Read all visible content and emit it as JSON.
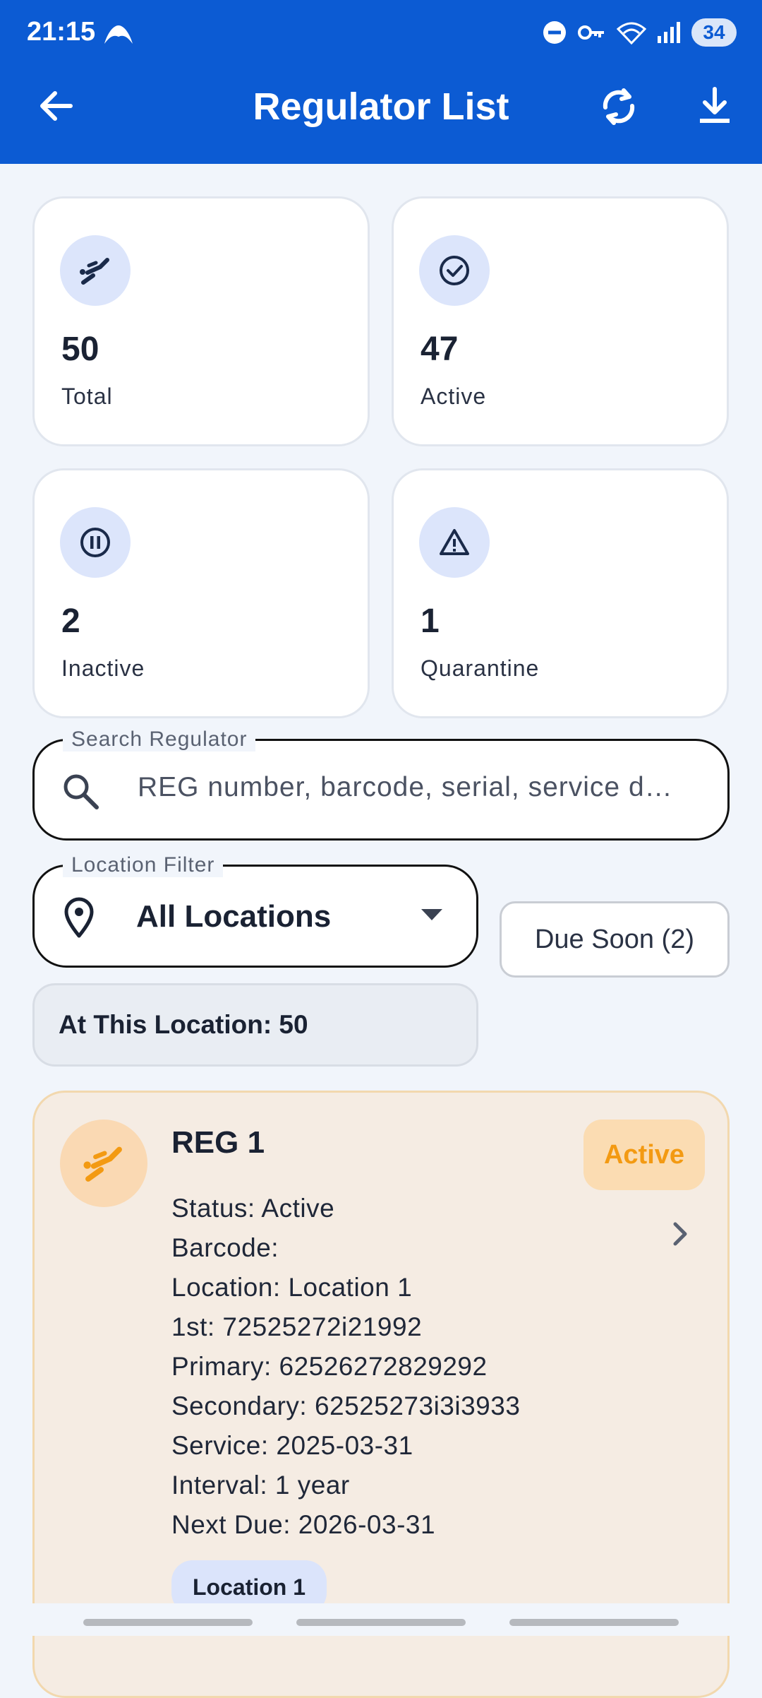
{
  "status_bar": {
    "time": "21:15",
    "battery": "34"
  },
  "header": {
    "title": "Regulator List"
  },
  "stats": [
    {
      "value": "50",
      "label": "Total"
    },
    {
      "value": "47",
      "label": "Active"
    },
    {
      "value": "2",
      "label": "Inactive"
    },
    {
      "value": "1",
      "label": "Quarantine"
    }
  ],
  "search": {
    "label": "Search Regulator",
    "placeholder": "REG number, barcode, serial, service d…"
  },
  "location_filter": {
    "label": "Location Filter",
    "value": "All Locations"
  },
  "due_soon_button": "Due Soon (2)",
  "location_count": "At This Location: 50",
  "regulators": [
    {
      "name": "REG 1",
      "badge": "Active",
      "lines": [
        "Status: Active",
        "Barcode:",
        "Location: Location 1",
        "1st: 72525272i21992",
        "Primary: 62526272829292",
        "Secondary: 62525273i3i3933",
        "Service: 2025-03-31",
        "Interval: 1 year",
        "Next Due: 2026-03-31"
      ],
      "chip": "Location 1"
    }
  ],
  "colors": {
    "primary": "#0c5bd3",
    "active_accent": "#f39a12",
    "card_active_bg": "#f5ece3"
  },
  "icons": [
    "back-arrow-icon",
    "sync-icon",
    "download-icon",
    "diver-icon",
    "check-circle-icon",
    "pause-circle-icon",
    "warning-icon",
    "search-icon",
    "location-pin-icon",
    "dropdown-caret-icon",
    "chevron-right-icon"
  ]
}
